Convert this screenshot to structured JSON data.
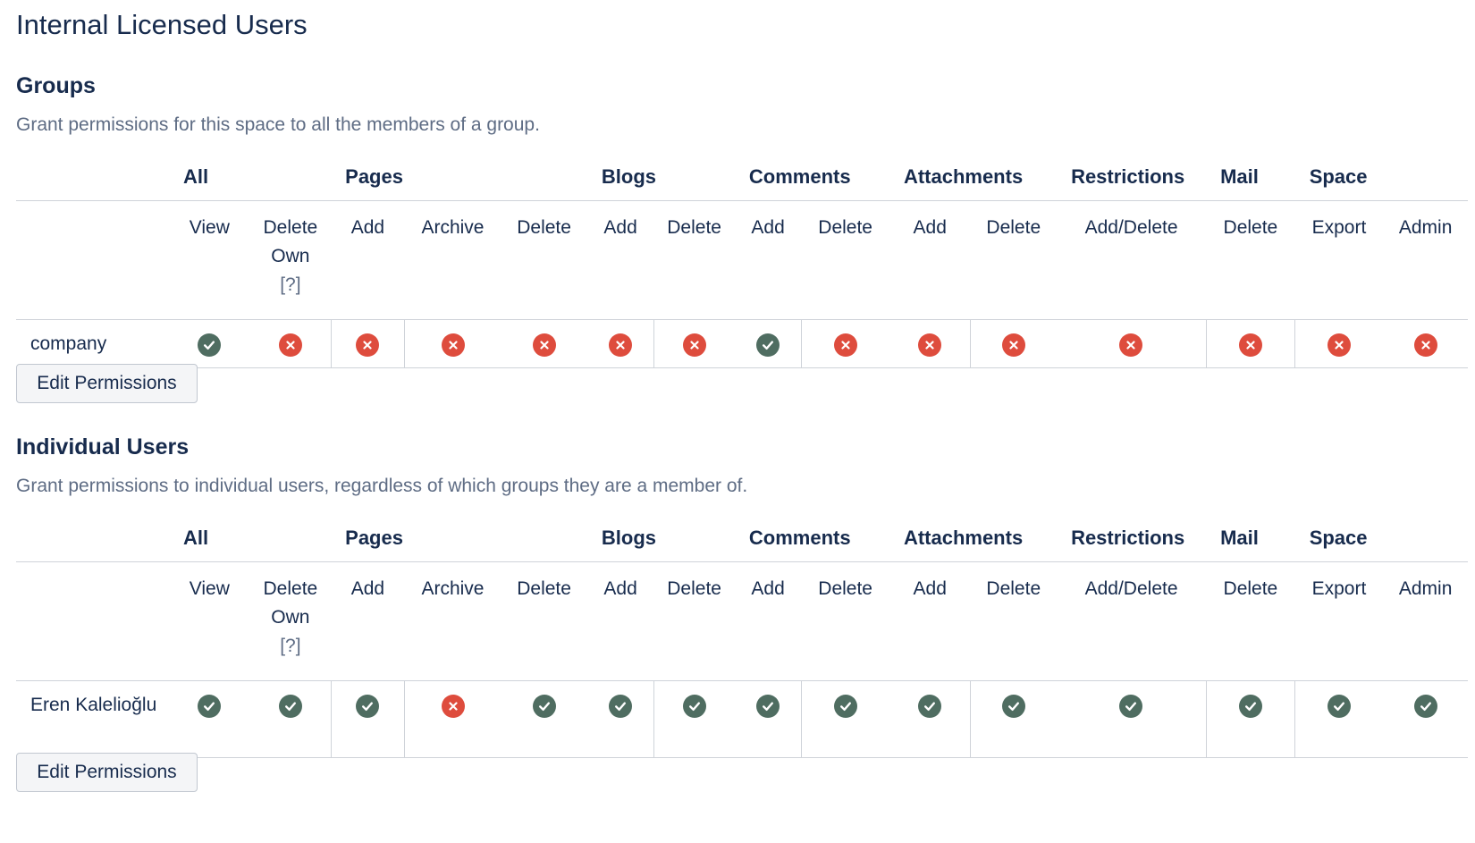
{
  "page_title": "Internal Licensed Users",
  "categories": {
    "all": "All",
    "pages": "Pages",
    "blogs": "Blogs",
    "comments": "Comments",
    "attachments": "Attachments",
    "restrictions": "Restrictions",
    "mail": "Mail",
    "space": "Space"
  },
  "columns": {
    "view": "View",
    "delete_own": "Delete Own",
    "delete_own_hint": "[?]",
    "pages_add": "Add",
    "pages_archive": "Archive",
    "pages_delete": "Delete",
    "blogs_add": "Add",
    "blogs_delete": "Delete",
    "comments_add": "Add",
    "comments_delete": "Delete",
    "attachments_add": "Add",
    "attachments_delete": "Delete",
    "restrictions_add_delete": "Add/Delete",
    "mail_delete": "Delete",
    "space_export": "Export",
    "space_admin": "Admin"
  },
  "groups": {
    "heading": "Groups",
    "description": "Grant permissions for this space to all the members of a group.",
    "rows": [
      {
        "name": "company",
        "permissions": [
          true,
          false,
          false,
          false,
          false,
          false,
          false,
          true,
          false,
          false,
          false,
          false,
          false,
          false,
          false
        ]
      }
    ],
    "edit_button": "Edit Permissions"
  },
  "individual_users": {
    "heading": "Individual Users",
    "description": "Grant permissions to individual users, regardless of which groups they are a member of.",
    "rows": [
      {
        "name": "Eren Kalelioğlu",
        "permissions": [
          true,
          true,
          true,
          false,
          true,
          true,
          true,
          true,
          true,
          true,
          true,
          true,
          true,
          true,
          true
        ]
      }
    ],
    "edit_button": "Edit Permissions"
  },
  "icons": {
    "granted": "check-circle-icon",
    "denied": "cross-circle-icon",
    "granted_color": "#4f6d61",
    "denied_color": "#de4c3d"
  }
}
